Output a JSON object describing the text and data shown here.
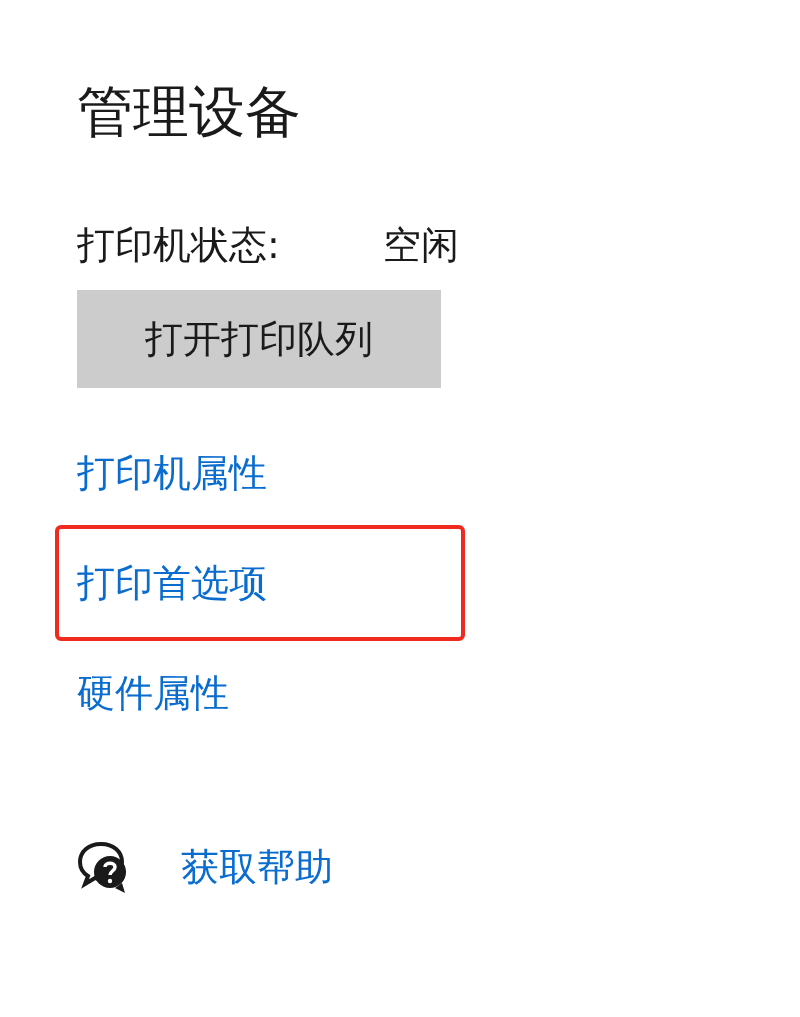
{
  "title": "管理设备",
  "status": {
    "label": "打印机状态:",
    "value": "空闲"
  },
  "queue_button": {
    "label": "打开打印队列"
  },
  "links": [
    {
      "label": "打印机属性",
      "highlighted": false
    },
    {
      "label": "打印首选项",
      "highlighted": true
    },
    {
      "label": "硬件属性",
      "highlighted": false
    }
  ],
  "help": {
    "label": "获取帮助"
  }
}
